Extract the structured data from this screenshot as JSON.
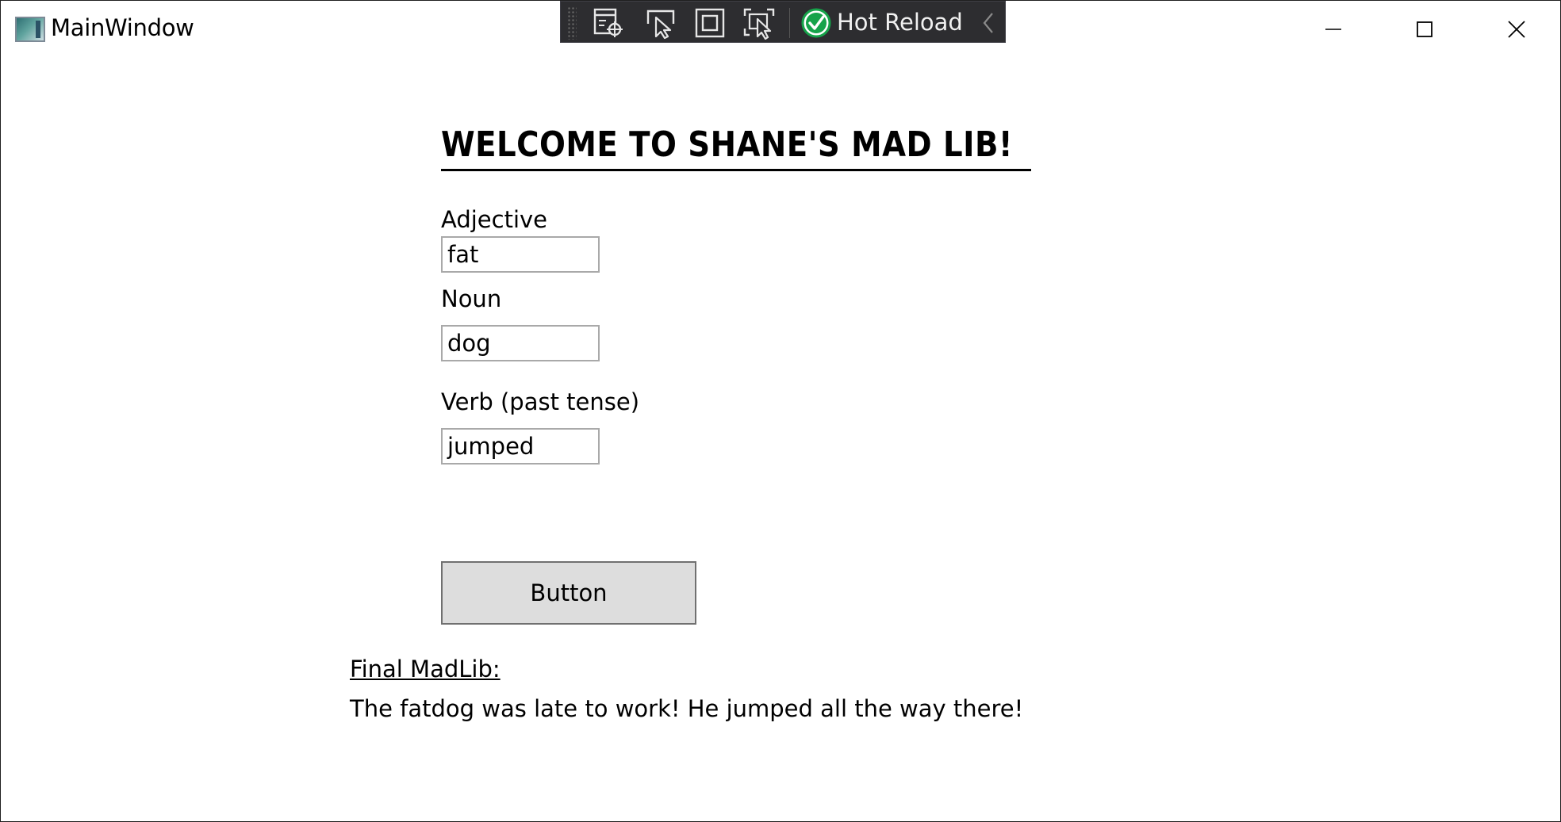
{
  "window": {
    "title": "MainWindow"
  },
  "hot_reload_toolbar": {
    "label": "Hot Reload",
    "status_color": "#16a34a",
    "icons": [
      "live-visual-tree-icon",
      "select-element-icon",
      "display-layout-adorners-icon",
      "track-focus-icon",
      "hot-reload-status-icon",
      "collapse-chevron-icon"
    ]
  },
  "main": {
    "heading": "Welcome to Shane's Mad Lib!",
    "fields": [
      {
        "label": "Adjective",
        "value": "fat"
      },
      {
        "label": "Noun",
        "value": "dog"
      },
      {
        "label": "Verb (past tense)",
        "value": "jumped"
      }
    ],
    "button_label": "Button",
    "result_label": "Final MadLib:",
    "result_text": "The fatdog was late to work! He jumped all the way there!"
  }
}
